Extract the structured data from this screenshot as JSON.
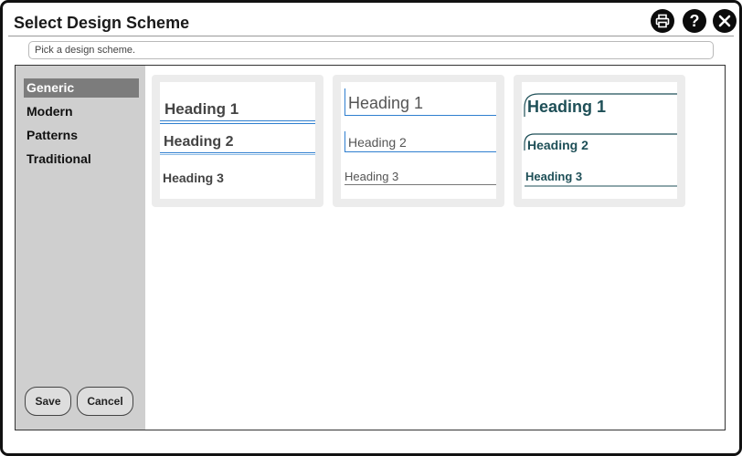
{
  "window": {
    "title": "Select Design Scheme"
  },
  "header_buttons": [
    {
      "icon": "printer-icon"
    },
    {
      "icon": "help-icon",
      "label": "?"
    },
    {
      "icon": "close-icon"
    }
  ],
  "instruction": "Pick a design scheme.",
  "sidebar": {
    "items": [
      {
        "label": "Generic",
        "active": true
      },
      {
        "label": "Modern"
      },
      {
        "label": "Patterns"
      },
      {
        "label": "Traditional"
      }
    ]
  },
  "actions": {
    "save_label": "Save",
    "cancel_label": "Cancel"
  },
  "schemes": [
    {
      "headings": [
        "Heading 1",
        "Heading 2",
        "Heading 3"
      ],
      "accent": "#2f7fcf",
      "text_color": "#444444"
    },
    {
      "headings": [
        "Heading 1",
        "Heading 2",
        "Heading 3"
      ],
      "accent": "#2f7fcf",
      "text_color": "#555555"
    },
    {
      "headings": [
        "Heading 1",
        "Heading 2",
        "Heading 3"
      ],
      "accent": "#1e4f57",
      "text_color": "#1e4f57"
    }
  ]
}
